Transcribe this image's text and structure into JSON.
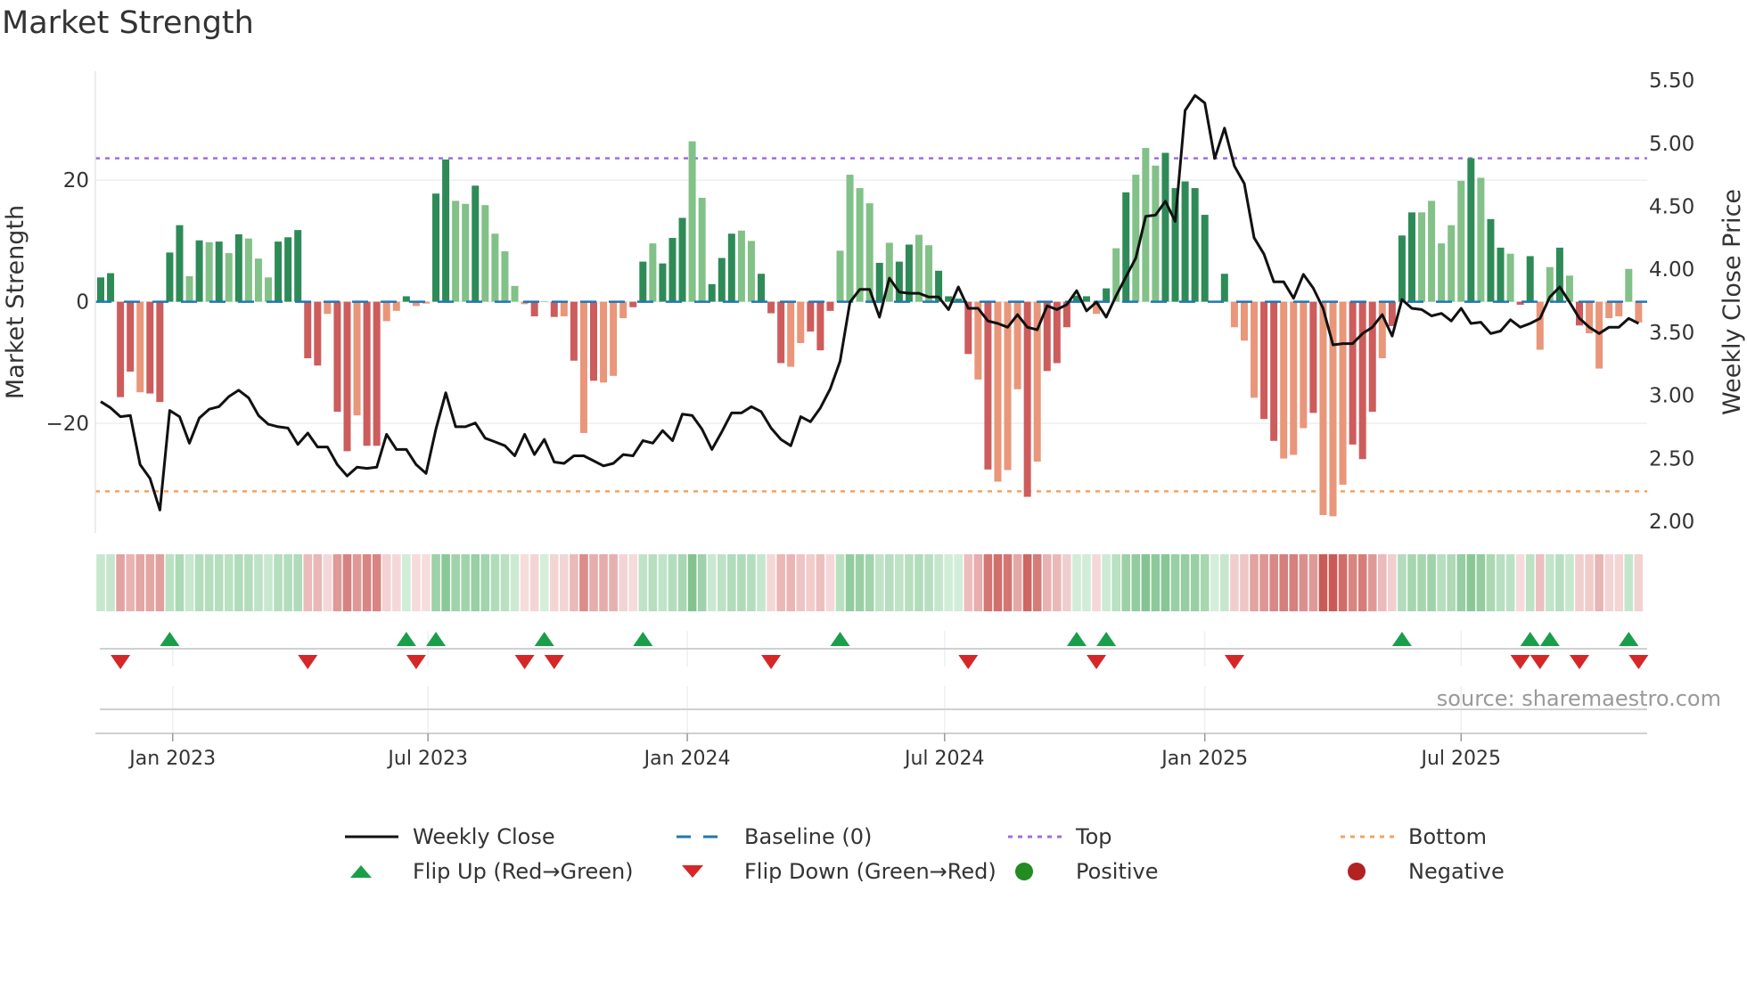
{
  "title": "Market Strength",
  "source": "source: sharemaestro.com",
  "colors": {
    "bar_pos_dark": "#2e8b57",
    "bar_pos_light": "#82c187",
    "bar_neg_dark": "#cd5c5c",
    "bar_neg_light": "#e9967a",
    "close_line": "#111111",
    "baseline": "#1f77b4",
    "top": "#9d6de0",
    "bottom": "#f2a35e",
    "flip_up": "#1a9e4a",
    "flip_down": "#d62728",
    "positive": "#228b22",
    "negative": "#b22222"
  },
  "legend": [
    {
      "label": "Weekly Close",
      "symbol": "line"
    },
    {
      "label": "Baseline (0)",
      "symbol": "dash"
    },
    {
      "label": "Top",
      "symbol": "dot-purple"
    },
    {
      "label": "Bottom",
      "symbol": "dot-orange"
    },
    {
      "label": "Flip Up (Red→Green)",
      "symbol": "triangle-up"
    },
    {
      "label": "Flip Down (Green→Red)",
      "symbol": "triangle-down"
    },
    {
      "label": "Positive",
      "symbol": "circle-green"
    },
    {
      "label": "Negative",
      "symbol": "circle-red"
    }
  ],
  "chart_data": {
    "type": "bar+line",
    "title": "Market Strength",
    "ylabel": "Market Strength",
    "y2label": "Weekly Close Price",
    "ylim": [
      -38,
      37
    ],
    "y2lim": [
      1.85,
      5.6
    ],
    "yticks": [
      {
        "v": 20,
        "label": "20"
      },
      {
        "v": 0,
        "label": "0"
      },
      {
        "v": -20,
        "label": "−20"
      }
    ],
    "y2ticks": [
      {
        "v": 5.5,
        "label": "5.50"
      },
      {
        "v": 5.0,
        "label": "5.00"
      },
      {
        "v": 4.5,
        "label": "4.50"
      },
      {
        "v": 4.0,
        "label": "4.00"
      },
      {
        "v": 3.5,
        "label": "3.50"
      },
      {
        "v": 3.0,
        "label": "3.00"
      },
      {
        "v": 2.5,
        "label": "2.50"
      },
      {
        "v": 2.0,
        "label": "2.00"
      }
    ],
    "xticks": [
      {
        "week": 7.3,
        "label": "Jan 2023"
      },
      {
        "week": 33.2,
        "label": "Jul 2023"
      },
      {
        "week": 59.5,
        "label": "Jan 2024"
      },
      {
        "week": 85.6,
        "label": "Jul 2024"
      },
      {
        "week": 112,
        "label": "Jan 2025"
      },
      {
        "week": 138,
        "label": "Jul 2025"
      }
    ],
    "top_level": 23.6,
    "bottom_level": -31.2,
    "baseline": 0,
    "strength": [
      4.0,
      4.7,
      -15.7,
      -11.5,
      -14.9,
      -15.1,
      -16.5,
      8.1,
      12.6,
      4.2,
      10.1,
      9.8,
      9.9,
      8.0,
      11.1,
      10.4,
      7.1,
      4.0,
      9.9,
      10.6,
      11.8,
      -9.3,
      -10.5,
      -2.0,
      -18.1,
      -24.6,
      -18.7,
      -23.7,
      -23.7,
      -3.2,
      -1.5,
      0.9,
      -0.7,
      -0.3,
      17.8,
      23.4,
      16.6,
      16.1,
      19.1,
      15.9,
      11.2,
      8.3,
      2.6,
      -0.4,
      -2.4,
      0.1,
      -2.5,
      -2.4,
      -9.7,
      -21.6,
      -13.0,
      -13.3,
      -12.2,
      -2.7,
      -0.9,
      6.6,
      9.6,
      6.3,
      10.5,
      13.8,
      26.4,
      17.1,
      2.9,
      7.2,
      11.2,
      11.7,
      10.0,
      4.6,
      -1.9,
      -10.1,
      -10.7,
      -6.8,
      -4.9,
      -8.0,
      -1.5,
      8.4,
      20.9,
      18.7,
      16.2,
      6.4,
      9.7,
      6.6,
      9.4,
      11.0,
      9.3,
      5.1,
      0.9,
      0.5,
      -8.6,
      -12.8,
      -27.6,
      -29.6,
      -27.7,
      -14.4,
      -32.1,
      -26.3,
      -11.4,
      -10.1,
      -4.2,
      1.0,
      0.9,
      -2.0,
      2.2,
      8.8,
      18.0,
      20.9,
      25.3,
      22.4,
      24.5,
      18.7,
      19.8,
      18.7,
      14.3,
      0.1,
      4.6,
      -4.2,
      -6.4,
      -15.8,
      -19.3,
      -22.9,
      -25.8,
      -25.2,
      -20.8,
      -18.3,
      -35.1,
      -35.3,
      -30.1,
      -23.5,
      -25.9,
      -18.1,
      -9.3,
      -4.0,
      10.9,
      14.7,
      14.7,
      16.6,
      9.6,
      12.6,
      19.9,
      23.6,
      20.4,
      13.6,
      8.9,
      7.9,
      -0.5,
      7.5,
      -7.9,
      5.7,
      8.9,
      4.3,
      -3.9,
      -5.2,
      -11.0,
      -2.7,
      -2.4,
      5.4,
      -3.4
    ],
    "shade": "ddddlddddldldldllldddddlddlddlldllddlldllllldldldldlllddldddlldddlldddlldddlllldlddllddddldllldldddddldldllldddddddlllddllldllldddldddllllldlddlddlldld",
    "weekly_close": [
      2.95,
      2.9,
      2.83,
      2.84,
      2.45,
      2.34,
      2.09,
      2.88,
      2.83,
      2.62,
      2.82,
      2.89,
      2.91,
      2.99,
      3.04,
      2.98,
      2.84,
      2.77,
      2.75,
      2.74,
      2.61,
      2.7,
      2.59,
      2.59,
      2.45,
      2.36,
      2.43,
      2.42,
      2.43,
      2.69,
      2.57,
      2.57,
      2.45,
      2.38,
      2.73,
      3.02,
      2.75,
      2.75,
      2.78,
      2.66,
      2.63,
      2.6,
      2.52,
      2.69,
      2.53,
      2.65,
      2.47,
      2.46,
      2.52,
      2.52,
      2.48,
      2.44,
      2.46,
      2.53,
      2.52,
      2.64,
      2.62,
      2.72,
      2.64,
      2.85,
      2.84,
      2.73,
      2.57,
      2.71,
      2.86,
      2.86,
      2.91,
      2.87,
      2.74,
      2.65,
      2.6,
      2.83,
      2.79,
      2.9,
      3.05,
      3.27,
      3.74,
      3.84,
      3.84,
      3.62,
      3.93,
      3.82,
      3.81,
      3.81,
      3.78,
      3.78,
      3.68,
      3.86,
      3.69,
      3.69,
      3.59,
      3.57,
      3.54,
      3.64,
      3.54,
      3.52,
      3.71,
      3.68,
      3.72,
      3.83,
      3.67,
      3.74,
      3.62,
      3.79,
      3.94,
      4.09,
      4.42,
      4.43,
      4.54,
      4.38,
      5.26,
      5.38,
      5.32,
      4.88,
      5.12,
      4.82,
      4.68,
      4.25,
      4.12,
      3.9,
      3.9,
      3.77,
      3.96,
      3.85,
      3.69,
      3.4,
      3.41,
      3.41,
      3.49,
      3.54,
      3.64,
      3.47,
      3.76,
      3.69,
      3.68,
      3.63,
      3.65,
      3.59,
      3.69,
      3.57,
      3.58,
      3.49,
      3.51,
      3.6,
      3.54,
      3.57,
      3.61,
      3.78,
      3.86,
      3.74,
      3.61,
      3.54,
      3.49,
      3.54,
      3.54,
      3.61,
      3.57
    ],
    "legend_placement": "bottom-center"
  }
}
